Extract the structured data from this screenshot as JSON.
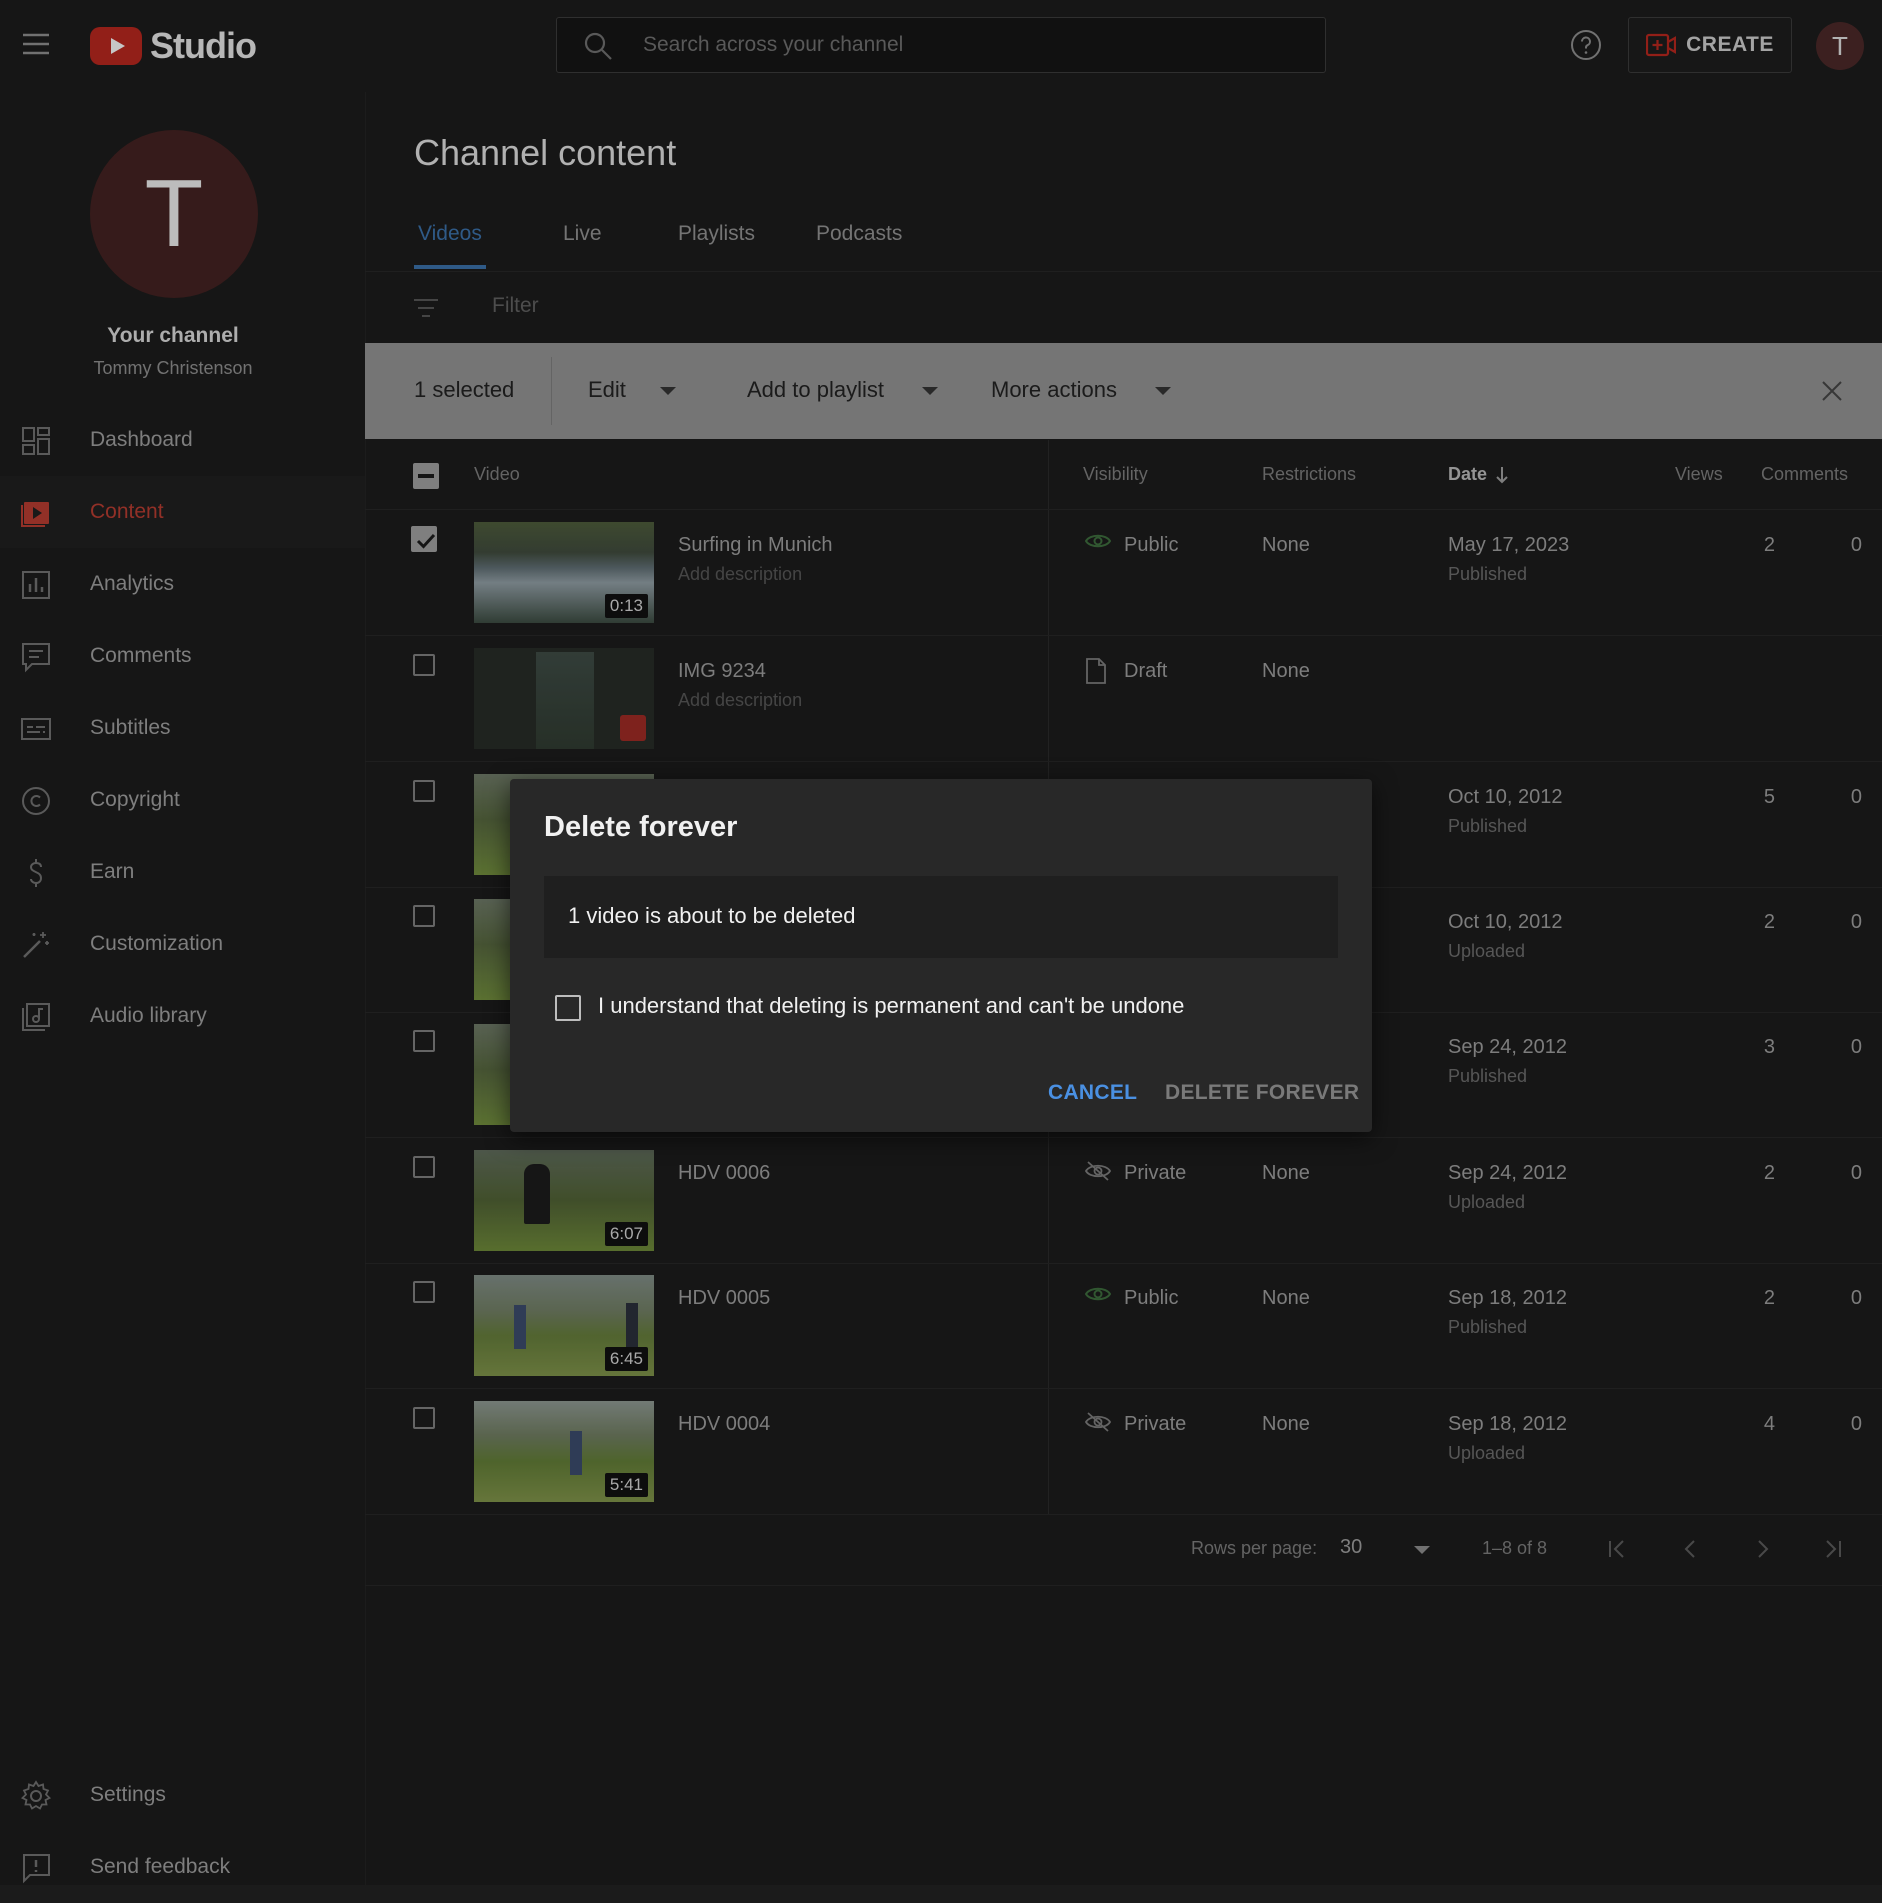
{
  "app": {
    "name": "Studio"
  },
  "search": {
    "placeholder": "Search across your channel"
  },
  "header": {
    "create_label": "CREATE",
    "avatar_letter": "T"
  },
  "sidebar": {
    "avatar_letter": "T",
    "your_channel": "Your channel",
    "channel_name": "Tommy Christenson",
    "items": [
      {
        "label": "Dashboard",
        "icon": "dashboard-icon"
      },
      {
        "label": "Content",
        "icon": "content-icon",
        "active": true
      },
      {
        "label": "Analytics",
        "icon": "analytics-icon"
      },
      {
        "label": "Comments",
        "icon": "comments-icon"
      },
      {
        "label": "Subtitles",
        "icon": "subtitles-icon"
      },
      {
        "label": "Copyright",
        "icon": "copyright-icon"
      },
      {
        "label": "Earn",
        "icon": "earn-icon"
      },
      {
        "label": "Customization",
        "icon": "customization-icon"
      },
      {
        "label": "Audio library",
        "icon": "audio-library-icon"
      }
    ],
    "bottom": [
      {
        "label": "Settings",
        "icon": "gear-icon"
      },
      {
        "label": "Send feedback",
        "icon": "feedback-icon"
      }
    ]
  },
  "main": {
    "title": "Channel content",
    "tabs": [
      {
        "label": "Videos",
        "active": true
      },
      {
        "label": "Live"
      },
      {
        "label": "Playlists"
      },
      {
        "label": "Podcasts"
      }
    ],
    "filter_placeholder": "Filter",
    "selection": {
      "count_label": "1 selected",
      "edit": "Edit",
      "add_to_playlist": "Add to playlist",
      "more_actions": "More actions"
    },
    "columns": {
      "video": "Video",
      "visibility": "Visibility",
      "restrictions": "Restrictions",
      "date": "Date",
      "views": "Views",
      "comments": "Comments"
    },
    "rows": [
      {
        "title": "Surfing in Munich",
        "desc": "Add description",
        "duration": "0:13",
        "visibility": "Public",
        "restrictions": "None",
        "date": "May 17, 2023",
        "status": "Published",
        "views": "2",
        "comments": "0",
        "checked": true
      },
      {
        "title": "IMG 9234",
        "desc": "Add description",
        "duration": "",
        "visibility": "Draft",
        "restrictions": "None",
        "date": "",
        "status": "",
        "views": "",
        "comments": ""
      },
      {
        "title": "",
        "desc": "",
        "duration": "",
        "visibility": "",
        "restrictions": "",
        "date": "Oct 10, 2012",
        "status": "Published",
        "views": "5",
        "comments": "0"
      },
      {
        "title": "",
        "desc": "",
        "duration": "",
        "visibility": "",
        "restrictions": "",
        "date": "Oct 10, 2012",
        "status": "Uploaded",
        "views": "2",
        "comments": "0"
      },
      {
        "title": "",
        "desc": "",
        "duration": "",
        "visibility": "",
        "restrictions": "",
        "date": "Sep 24, 2012",
        "status": "Published",
        "views": "3",
        "comments": "0"
      },
      {
        "title": "HDV 0006",
        "desc": "",
        "duration": "6:07",
        "visibility": "Private",
        "restrictions": "None",
        "date": "Sep 24, 2012",
        "status": "Uploaded",
        "views": "2",
        "comments": "0"
      },
      {
        "title": "HDV 0005",
        "desc": "",
        "duration": "6:45",
        "visibility": "Public",
        "restrictions": "None",
        "date": "Sep 18, 2012",
        "status": "Published",
        "views": "2",
        "comments": "0"
      },
      {
        "title": "HDV 0004",
        "desc": "",
        "duration": "5:41",
        "visibility": "Private",
        "restrictions": "None",
        "date": "Sep 18, 2012",
        "status": "Uploaded",
        "views": "4",
        "comments": "0"
      }
    ],
    "pagination": {
      "rows_per_page_label": "Rows per page:",
      "rows_per_page": "30",
      "range": "1–8 of 8"
    }
  },
  "dialog": {
    "title": "Delete forever",
    "message": "1 video is about to be deleted",
    "checkbox_label": "I understand that deleting is permanent and can't be undone",
    "cancel": "CANCEL",
    "confirm": "DELETE FOREVER"
  },
  "colors": {
    "accent_red": "#b23b30",
    "link_blue": "#4a90e2",
    "tab_blue": "#3a6ea5",
    "public_green": "#3c6b3c"
  }
}
